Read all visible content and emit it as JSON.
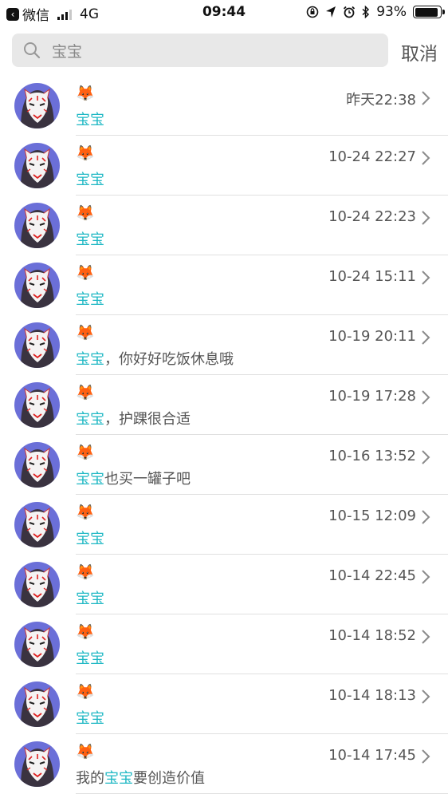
{
  "status_bar": {
    "back_app": "微信",
    "network": "4G",
    "time": "09:44",
    "battery": "93%",
    "battery_level": 0.93,
    "icons": [
      "rotation-lock-icon",
      "location-icon",
      "alarm-icon",
      "bluetooth-icon"
    ]
  },
  "search": {
    "value": "宝宝",
    "cancel_label": "取消"
  },
  "accent_color": "#1fb8c4",
  "results": [
    {
      "nick": "🦊",
      "pre": "",
      "hl": "宝宝",
      "post": "",
      "time": "昨天22:38"
    },
    {
      "nick": "🦊",
      "pre": "",
      "hl": "宝宝",
      "post": "",
      "time": "10-24 22:27"
    },
    {
      "nick": "🦊",
      "pre": "",
      "hl": "宝宝",
      "post": "",
      "time": "10-24 22:23"
    },
    {
      "nick": "🦊",
      "pre": "",
      "hl": "宝宝",
      "post": "",
      "time": "10-24 15:11"
    },
    {
      "nick": "🦊",
      "pre": "",
      "hl": "宝宝",
      "post": "，你好好吃饭休息哦",
      "time": "10-19 20:11"
    },
    {
      "nick": "🦊",
      "pre": "",
      "hl": "宝宝",
      "post": "，护踝很合适",
      "time": "10-19 17:28"
    },
    {
      "nick": "🦊",
      "pre": "",
      "hl": "宝宝",
      "post": "也买一罐子吧",
      "time": "10-16 13:52"
    },
    {
      "nick": "🦊",
      "pre": "",
      "hl": "宝宝",
      "post": "",
      "time": "10-15 12:09"
    },
    {
      "nick": "🦊",
      "pre": "",
      "hl": "宝宝",
      "post": "",
      "time": "10-14 22:45"
    },
    {
      "nick": "🦊",
      "pre": "",
      "hl": "宝宝",
      "post": "",
      "time": "10-14 18:52"
    },
    {
      "nick": "🦊",
      "pre": "",
      "hl": "宝宝",
      "post": "",
      "time": "10-14 18:13"
    },
    {
      "nick": "🦊",
      "pre": "我的",
      "hl": "宝宝",
      "post": "要创造价值",
      "time": "10-14 17:45"
    }
  ]
}
